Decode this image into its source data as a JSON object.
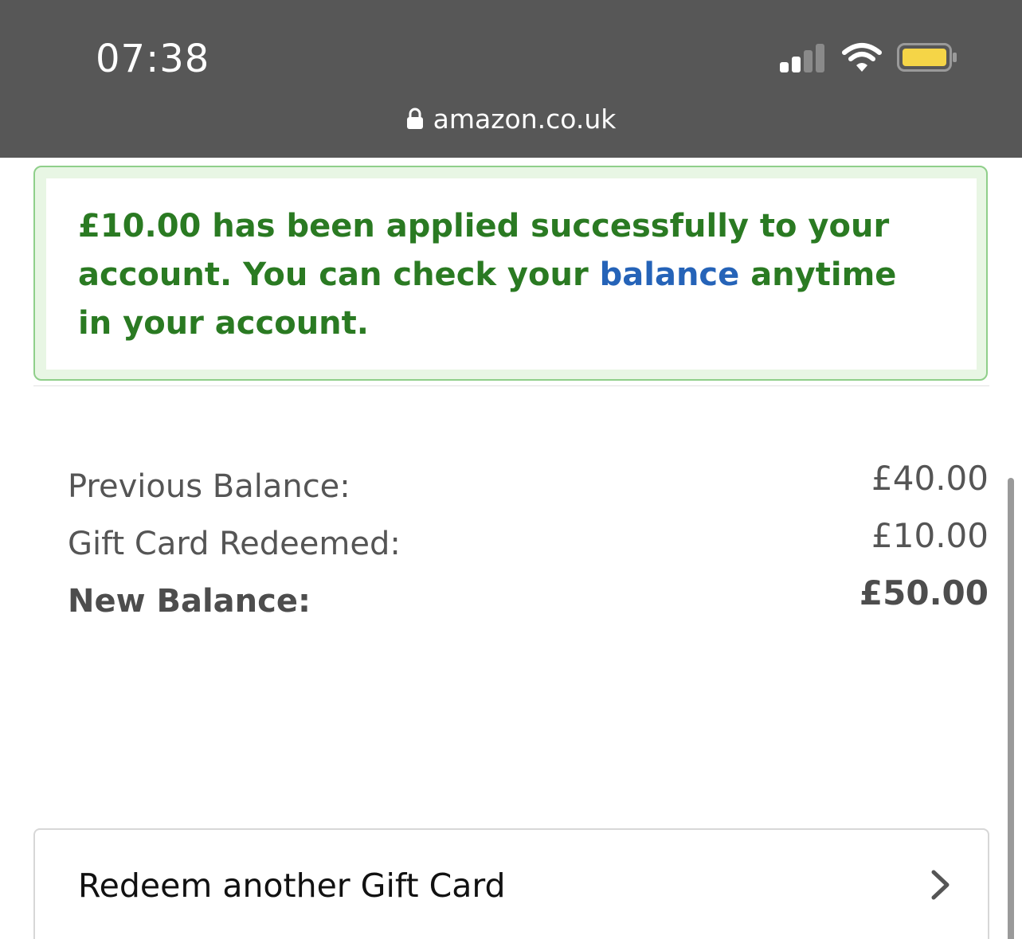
{
  "status_bar": {
    "time": "07:38",
    "battery_color": "#f5d547",
    "signal_bars_active": 2,
    "signal_bars_total": 4
  },
  "browser": {
    "url": "amazon.co.uk"
  },
  "alert": {
    "message_before_link": "£10.00 has been applied successfully to your account. You can check your ",
    "link_text": "balance",
    "message_after_link": " anytime in your account.",
    "text_color": "#2a7a22",
    "link_color": "#2563b8"
  },
  "summary": {
    "previous_balance_label": "Previous Balance:",
    "previous_balance_value": "£40.00",
    "redeemed_label": "Gift Card Redeemed:",
    "redeemed_value": "£10.00",
    "new_balance_label": "New Balance:",
    "new_balance_value": "£50.00"
  },
  "actions": {
    "redeem_another_label": "Redeem another Gift Card"
  }
}
